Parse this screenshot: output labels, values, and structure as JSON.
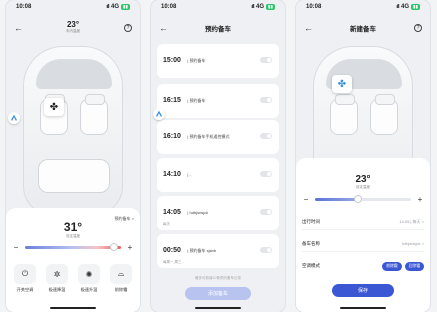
{
  "status": {
    "time": "10:08",
    "signal": "4G"
  },
  "screen1": {
    "cabin_temp": "23°",
    "cabin_temp_label": "车内温度",
    "set_temp": "31°",
    "set_temp_label": "设定温度",
    "reserve_link": "预约备车 >",
    "temp_level": 0.93,
    "quick_actions": [
      {
        "icon": "power-icon",
        "glyph": "⏻",
        "label": "开关空调"
      },
      {
        "icon": "fan-cool-icon",
        "glyph": "✲",
        "label": "极速降温"
      },
      {
        "icon": "fan-heat-icon",
        "glyph": "✺",
        "label": "极速升温"
      },
      {
        "icon": "defrost-icon",
        "glyph": "⌓",
        "label": "前除霜"
      }
    ]
  },
  "screen2": {
    "title": "预约备车",
    "items": [
      {
        "time": "15:00",
        "name": "| 预约备车",
        "sub": ""
      },
      {
        "time": "16:15",
        "name": "| 预约备车",
        "sub": ""
      },
      {
        "time": "16:10",
        "name": "| 预约备车手机遥控模式",
        "sub": ""
      },
      {
        "time": "14:10",
        "name": "| -",
        "sub": ""
      },
      {
        "time": "14:05",
        "name": "| hdbjsnsjck",
        "sub": "每天"
      },
      {
        "time": "00:50",
        "name": "| 预约备车 sjsbb",
        "sub": "每周一,周三"
      }
    ],
    "footnote": "最多可新增10条预约备车记录",
    "add_button": "添加备车"
  },
  "screen3": {
    "title": "新建备车",
    "cabin_temp": "23°",
    "cabin_temp_label": "设定温度",
    "temp_level": 0.45,
    "rows": [
      {
        "key": "出行时间",
        "value": "14:05 | 每天 >"
      },
      {
        "key": "备车名称",
        "value": "hdbjsnsjck >"
      }
    ],
    "mode_label": "空调模式",
    "mode_chips": [
      "前除霜",
      "后除霜"
    ],
    "save_button": "保存"
  }
}
